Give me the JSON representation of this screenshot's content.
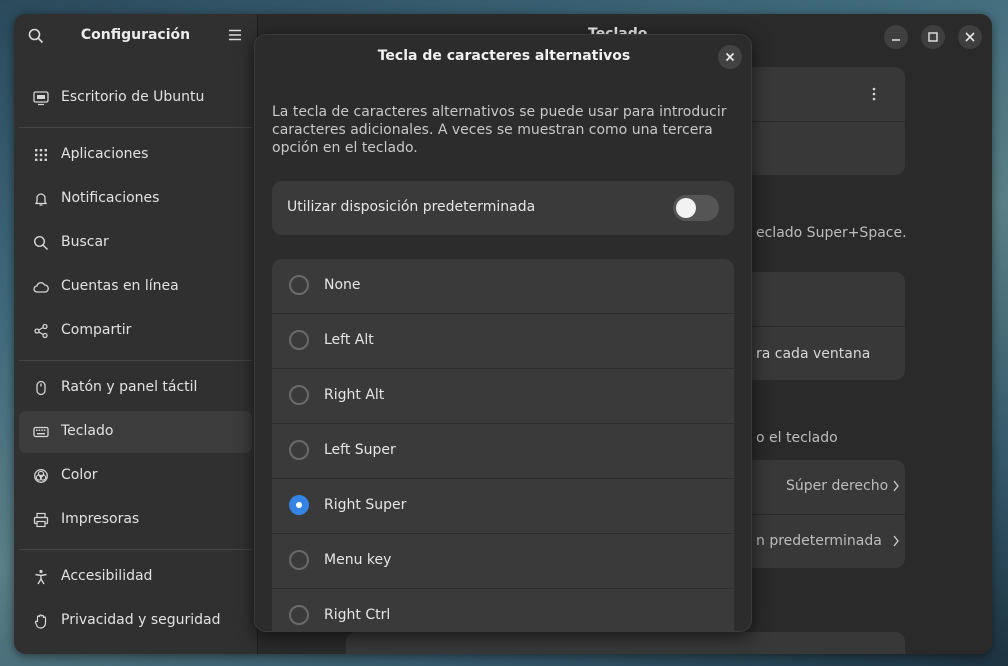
{
  "sidebar": {
    "title": "Configuración",
    "items": [
      {
        "label": "Escritorio de Ubuntu",
        "icon": "desktop-icon"
      },
      {
        "label": "Aplicaciones",
        "icon": "apps-grid-icon"
      },
      {
        "label": "Notificaciones",
        "icon": "bell-icon"
      },
      {
        "label": "Buscar",
        "icon": "search-icon"
      },
      {
        "label": "Cuentas en línea",
        "icon": "cloud-icon"
      },
      {
        "label": "Compartir",
        "icon": "share-icon"
      },
      {
        "label": "Ratón y panel táctil",
        "icon": "mouse-icon"
      },
      {
        "label": "Teclado",
        "icon": "keyboard-icon",
        "selected": true
      },
      {
        "label": "Color",
        "icon": "color-icon"
      },
      {
        "label": "Impresoras",
        "icon": "printer-icon"
      },
      {
        "label": "Accesibilidad",
        "icon": "accessibility-icon"
      },
      {
        "label": "Privacidad y seguridad",
        "icon": "hand-icon"
      }
    ]
  },
  "main": {
    "title": "Teclado",
    "partial_text": {
      "shortcut_hint": "eclado Super+Space.",
      "per_window": "ra cada ventana",
      "keyboard_heading": "o el teclado",
      "compose_value": "Súper derecho",
      "alt_chars_value": "n predeterminada"
    }
  },
  "dialog": {
    "title": "Tecla de caracteres alternativos",
    "description": "La tecla de caracteres alternativos se puede usar para introducir caracteres adicionales. A veces se muestran como una tercera opción en el teclado.",
    "default_layout_label": "Utilizar disposición predeterminada",
    "default_layout_on": false,
    "options": [
      {
        "label": "None",
        "checked": false
      },
      {
        "label": "Left Alt",
        "checked": false
      },
      {
        "label": "Right Alt",
        "checked": false
      },
      {
        "label": "Left Super",
        "checked": false
      },
      {
        "label": "Right Super",
        "checked": true
      },
      {
        "label": "Menu key",
        "checked": false
      },
      {
        "label": "Right Ctrl",
        "checked": false
      }
    ]
  },
  "colors": {
    "accent": "#3584e4"
  }
}
